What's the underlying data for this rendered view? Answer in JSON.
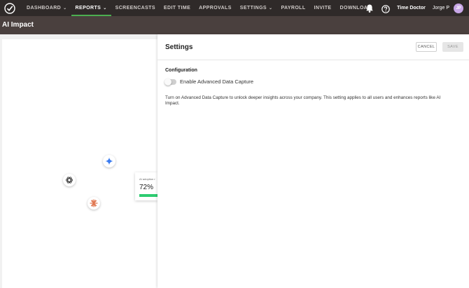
{
  "nav": {
    "items": [
      {
        "label": "DASHBOARD",
        "dropdown": true,
        "active": false
      },
      {
        "label": "REPORTS",
        "dropdown": true,
        "active": true
      },
      {
        "label": "SCREENCASTS",
        "dropdown": false,
        "active": false
      },
      {
        "label": "EDIT TIME",
        "dropdown": false,
        "active": false
      },
      {
        "label": "APPROVALS",
        "dropdown": false,
        "active": false
      },
      {
        "label": "SETTINGS",
        "dropdown": true,
        "active": false
      },
      {
        "label": "PAYROLL",
        "dropdown": false,
        "active": false
      },
      {
        "label": "INVITE",
        "dropdown": false,
        "active": false
      },
      {
        "label": "DOWNLOAD",
        "dropdown": false,
        "active": false
      }
    ],
    "org_name": "Time Doctor",
    "user_name": "Jorge P",
    "avatar_initials": "JP",
    "icons": {
      "notifications": "bell-icon",
      "help": "help-icon",
      "logo": "time-doctor-logo"
    },
    "accent_color": "#4caf50"
  },
  "page": {
    "title": "AI Impact"
  },
  "overview": {
    "adoption_label": "AI adoption r",
    "adoption_value": "72%",
    "adoption_fraction": 0.72,
    "tool_icons": [
      "gemini-icon",
      "openai-icon",
      "claude-icon"
    ]
  },
  "settings": {
    "title": "Settings",
    "cancel_label": "CANCEL",
    "save_label": "SAVE",
    "section_title": "Configuration",
    "toggle_label": "Enable Advanced Data Capture",
    "toggle_on": false,
    "description": "Turn on Advanced Data Capture to unlock deeper insights across your company. This setting applies to all users and enhances reports like AI Impact."
  }
}
